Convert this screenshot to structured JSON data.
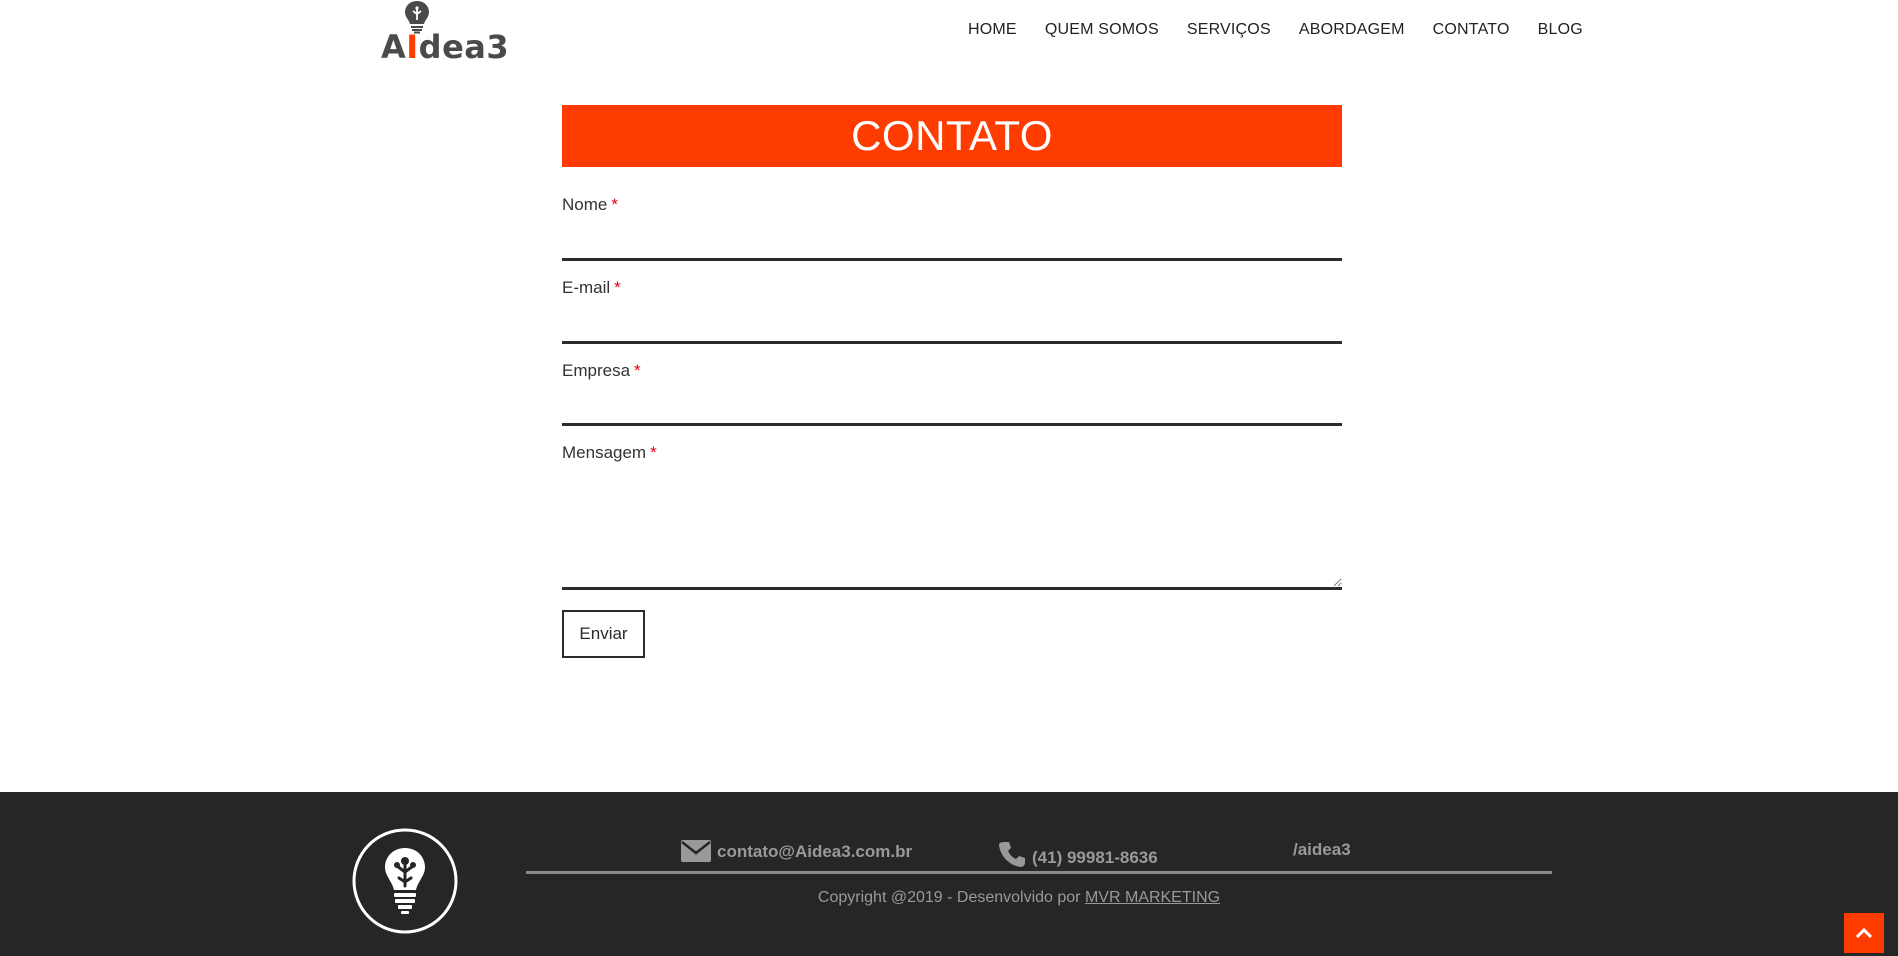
{
  "header": {
    "logo_text_a": "A",
    "logo_text_i": "I",
    "logo_text_rest": "dea3",
    "nav": [
      "HOME",
      "QUEM SOMOS",
      "SERVIÇOS",
      "ABORDAGEM",
      "CONTATO",
      "BLOG"
    ]
  },
  "form": {
    "title": "CONTATO",
    "fields": {
      "name_label": "Nome",
      "email_label": "E-mail",
      "company_label": "Empresa",
      "message_label": "Mensagem",
      "required_mark": "*"
    },
    "submit_label": "Enviar"
  },
  "footer": {
    "email": "contato@Aidea3.com.br",
    "phone": "(41) 99981-8636",
    "social": "/aidea3",
    "copyright_prefix": "Copyright @2019 - Desenvolvido por ",
    "copyright_link": "MVR MARKETING"
  },
  "colors": {
    "accent": "#ff3c00",
    "footer_bg": "#262626",
    "required": "#e0001b"
  },
  "icons": {
    "logo": "lightbulb-icon",
    "email": "envelope-icon",
    "phone": "phone-icon",
    "scroll_top": "chevron-up-icon"
  }
}
